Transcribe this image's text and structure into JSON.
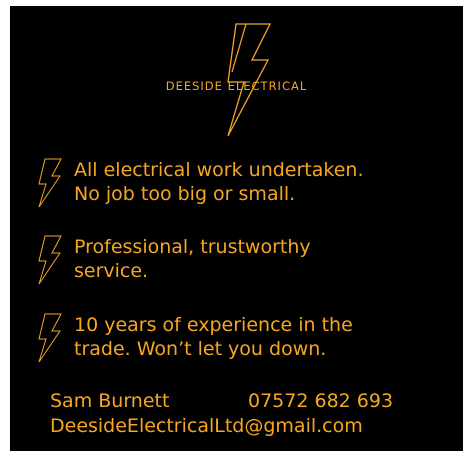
{
  "brand": {
    "name": "DEESIDE ELECTRICAL",
    "icon": "lightning-bolt-icon",
    "accent_color": "#f5a623",
    "background_color": "#000000"
  },
  "bullets": [
    {
      "icon": "lightning-bolt-icon",
      "text": "All electrical work undertaken.\nNo job too big or small."
    },
    {
      "icon": "lightning-bolt-icon",
      "text": "Professional, trustworthy\nservice."
    },
    {
      "icon": "lightning-bolt-icon",
      "text": "10 years of experience in the\ntrade. Won’t let you down."
    }
  ],
  "contact": {
    "name": "Sam Burnett",
    "phone": "07572 682 693",
    "email": "DeesideElectricalLtd@gmail.com"
  }
}
